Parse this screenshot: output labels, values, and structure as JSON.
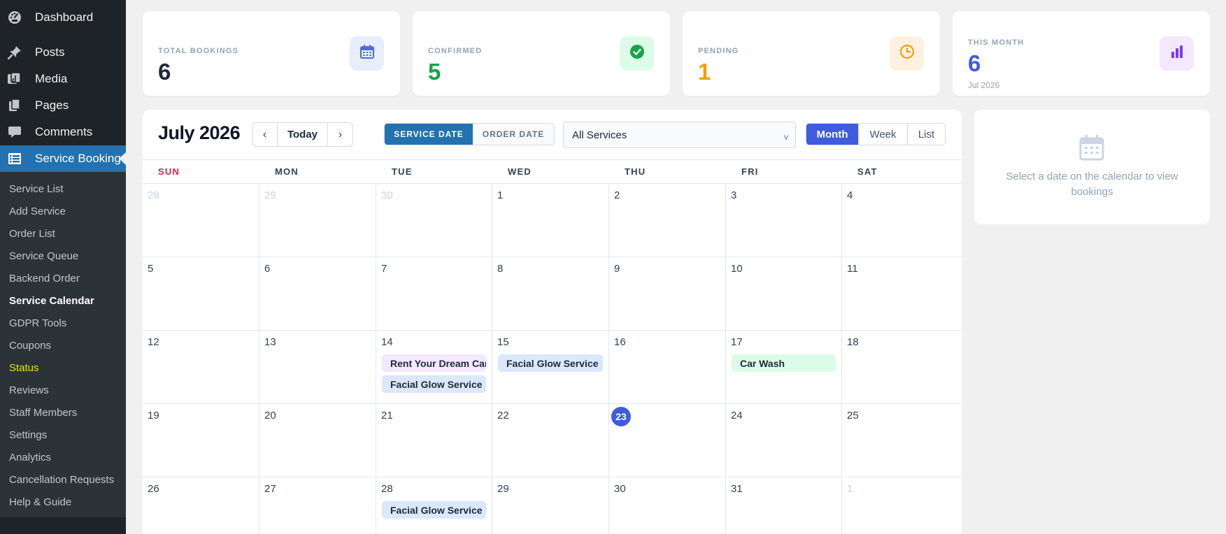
{
  "sidebar": {
    "top_items": [
      {
        "label": "Dashboard",
        "icon": "gauge-icon"
      },
      {
        "label": "Posts",
        "icon": "pushpin-icon"
      },
      {
        "label": "Media",
        "icon": "media-icon"
      },
      {
        "label": "Pages",
        "icon": "pages-icon"
      },
      {
        "label": "Comments",
        "icon": "comment-icon"
      }
    ],
    "active_item": {
      "label": "Service Booking",
      "icon": "list-icon"
    },
    "sub_items": [
      "Service List",
      "Add Service",
      "Order List",
      "Service Queue",
      "Backend Order",
      "Service Calendar",
      "GDPR Tools",
      "Coupons",
      "Status",
      "Reviews",
      "Staff Members",
      "Settings",
      "Analytics",
      "Cancellation Requests",
      "Help & Guide"
    ],
    "current_sub_item": "Service Calendar",
    "highlighted_sub_item": "Status"
  },
  "stats": [
    {
      "label": "TOTAL BOOKINGS",
      "value": "6",
      "icon": "calendar-icon",
      "value_color": "#1e293b",
      "badge_bg": "#e8edfc",
      "icon_color": "#4f6ae0"
    },
    {
      "label": "CONFIRMED",
      "value": "5",
      "icon": "check-circle-icon",
      "value_color": "#16a34a",
      "badge_bg": "#dcfce7",
      "icon_color": "#16a34a"
    },
    {
      "label": "PENDING",
      "value": "1",
      "icon": "clock-icon",
      "value_color": "#f59e0b",
      "badge_bg": "#fff1e0",
      "icon_color": "#f59e0b"
    },
    {
      "label": "THIS MONTH",
      "value": "6",
      "sub": "Jul 2026",
      "icon": "bar-chart-icon",
      "value_color": "#3f5bdf",
      "badge_bg": "#f3e8ff",
      "icon_color": "#7c3aed"
    }
  ],
  "calendar": {
    "title": "July 2026",
    "nav": {
      "prev": "‹",
      "today": "Today",
      "next": "›"
    },
    "date_toggle": {
      "service_date": "SERVICE DATE",
      "order_date": "ORDER DATE",
      "selected": "service_date"
    },
    "service_filter": {
      "value": "All Services",
      "caret": "v"
    },
    "views": {
      "month": "Month",
      "week": "Week",
      "list": "List",
      "selected": "month"
    },
    "weekdays": [
      "SUN",
      "MON",
      "TUE",
      "WED",
      "THU",
      "FRI",
      "SAT"
    ],
    "weeks": [
      [
        {
          "n": "28",
          "other": true
        },
        {
          "n": "29",
          "other": true
        },
        {
          "n": "30",
          "other": true
        },
        {
          "n": "1"
        },
        {
          "n": "2"
        },
        {
          "n": "3"
        },
        {
          "n": "4"
        }
      ],
      [
        {
          "n": "5"
        },
        {
          "n": "6"
        },
        {
          "n": "7"
        },
        {
          "n": "8"
        },
        {
          "n": "9"
        },
        {
          "n": "10"
        },
        {
          "n": "11"
        }
      ],
      [
        {
          "n": "12"
        },
        {
          "n": "13"
        },
        {
          "n": "14",
          "events": [
            {
              "title": "Rent Your Dream Car",
              "color": "#f3e8ff"
            },
            {
              "title": "Facial Glow Service",
              "color": "#dbe7fb"
            }
          ]
        },
        {
          "n": "15",
          "events": [
            {
              "title": "Facial Glow Service",
              "color": "#dbe7fb"
            }
          ]
        },
        {
          "n": "16"
        },
        {
          "n": "17",
          "events": [
            {
              "title": "Car Wash",
              "color": "#dcfce7"
            }
          ]
        },
        {
          "n": "18"
        }
      ],
      [
        {
          "n": "19"
        },
        {
          "n": "20"
        },
        {
          "n": "21"
        },
        {
          "n": "22"
        },
        {
          "n": "23",
          "today": true
        },
        {
          "n": "24"
        },
        {
          "n": "25"
        }
      ],
      [
        {
          "n": "26"
        },
        {
          "n": "27"
        },
        {
          "n": "28",
          "events": [
            {
              "title": "Facial Glow Service",
              "color": "#dbe7fb"
            }
          ]
        },
        {
          "n": "29"
        },
        {
          "n": "30"
        },
        {
          "n": "31"
        },
        {
          "n": "1",
          "other": true
        }
      ]
    ]
  },
  "details": {
    "message": "Select a date on the calendar to view bookings",
    "icon": "calendar-icon"
  }
}
